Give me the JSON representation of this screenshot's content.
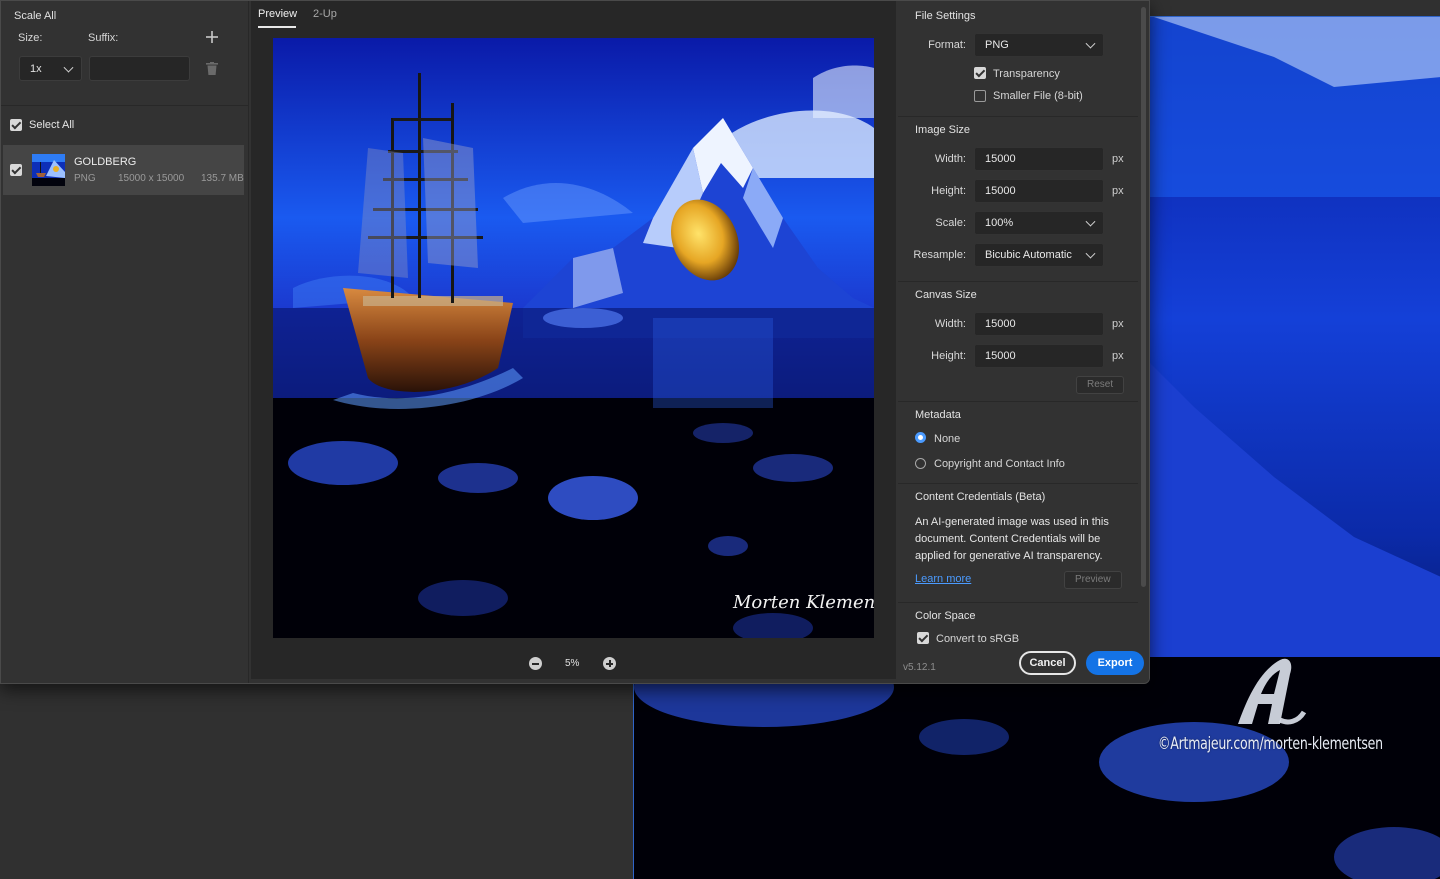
{
  "left_panel": {
    "title": "Scale All",
    "size_label": "Size:",
    "suffix_label": "Suffix:",
    "scale_value": "1x",
    "suffix_value": "",
    "select_all_label": "Select All",
    "select_all_checked": true,
    "asset": {
      "name": "GOLDBERG",
      "format": "PNG",
      "dimensions": "15000 x 15000",
      "filesize": "135.7 MB",
      "checked": true
    }
  },
  "preview": {
    "tabs": [
      "Preview",
      "2-Up"
    ],
    "active_tab": "Preview",
    "zoom": "5%",
    "signature": "Morten Klementsen"
  },
  "file_settings": {
    "title": "File Settings",
    "format_label": "Format:",
    "format_value": "PNG",
    "transparency_label": "Transparency",
    "transparency_checked": true,
    "smaller_file_label": "Smaller File (8-bit)",
    "smaller_file_checked": false
  },
  "image_size": {
    "title": "Image Size",
    "width_label": "Width:",
    "width_value": "15000",
    "height_label": "Height:",
    "height_value": "15000",
    "unit": "px",
    "scale_label": "Scale:",
    "scale_value": "100%",
    "resample_label": "Resample:",
    "resample_value": "Bicubic Automatic"
  },
  "canvas_size": {
    "title": "Canvas Size",
    "width_label": "Width:",
    "width_value": "15000",
    "height_label": "Height:",
    "height_value": "15000",
    "unit": "px",
    "reset_label": "Reset"
  },
  "metadata": {
    "title": "Metadata",
    "options": [
      "None",
      "Copyright and Contact Info"
    ],
    "selected": "None"
  },
  "content_credentials": {
    "title": "Content Credentials (Beta)",
    "text_line1": "An AI-generated image was used in this",
    "text_line2": "document. Content Credentials will be",
    "text_line3": "applied for generative AI transparency.",
    "learn_more": "Learn more",
    "preview_label": "Preview"
  },
  "color_space": {
    "title": "Color Space",
    "convert_label": "Convert to sRGB",
    "convert_checked": true
  },
  "footer": {
    "version": "v5.12.1",
    "cancel_label": "Cancel",
    "export_label": "Export"
  },
  "watermark": {
    "text": "©Artmajeur.com/morten-klementsen"
  },
  "colors": {
    "accent": "#1473e6",
    "radio_selected": "#4b9bff",
    "link": "#4b9bff",
    "dialog_bg": "#323232",
    "preview_bg": "#272727"
  }
}
